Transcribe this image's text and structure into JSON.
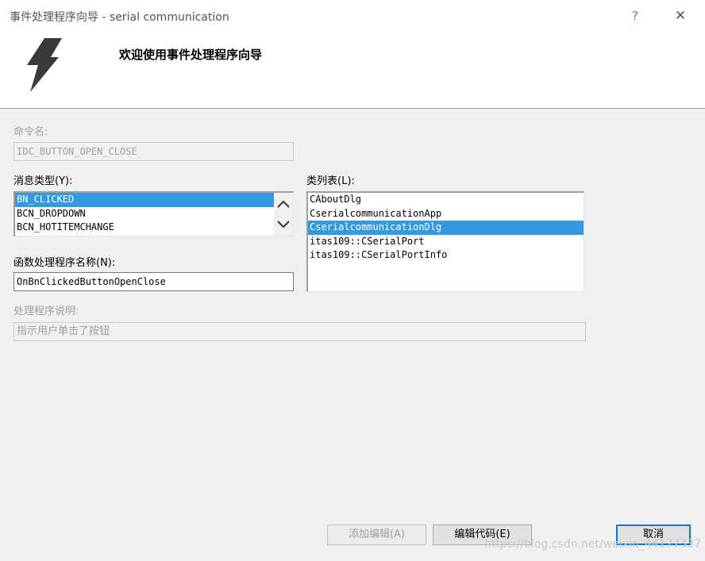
{
  "window": {
    "title": "事件处理程序向导 - serial communication",
    "help_label": "?",
    "close_label": "✕"
  },
  "header": {
    "title": "欢迎使用事件处理程序向导",
    "icon": "lightning-icon"
  },
  "command_name": {
    "label": "命令名:",
    "value": "IDC_BUTTON_OPEN_CLOSE"
  },
  "message_type": {
    "label": "消息类型(Y):",
    "items": [
      "BN_CLICKED",
      "BCN_DROPDOWN",
      "BCN_HOTITEMCHANGE"
    ],
    "selected_index": 0
  },
  "class_list": {
    "label": "类列表(L):",
    "items": [
      "CAboutDlg",
      "CserialcommunicationApp",
      "CserialcommunicationDlg",
      "itas109::CSerialPort",
      "itas109::CSerialPortInfo"
    ],
    "selected_index": 2
  },
  "handler_name": {
    "label": "函数处理程序名称(N):",
    "value": "OnBnClickedButtonOpenClose"
  },
  "handler_desc": {
    "label": "处理程序说明:",
    "value": "指示用户单击了按钮"
  },
  "buttons": {
    "add_edit": "添加编辑(A)",
    "edit_code": "编辑代码(E)",
    "cancel": "取消"
  },
  "watermark": "https://blog.csdn.net/weixin_44177337",
  "colors": {
    "selection": "#3399e0",
    "default_button_border": "#0078d7"
  }
}
